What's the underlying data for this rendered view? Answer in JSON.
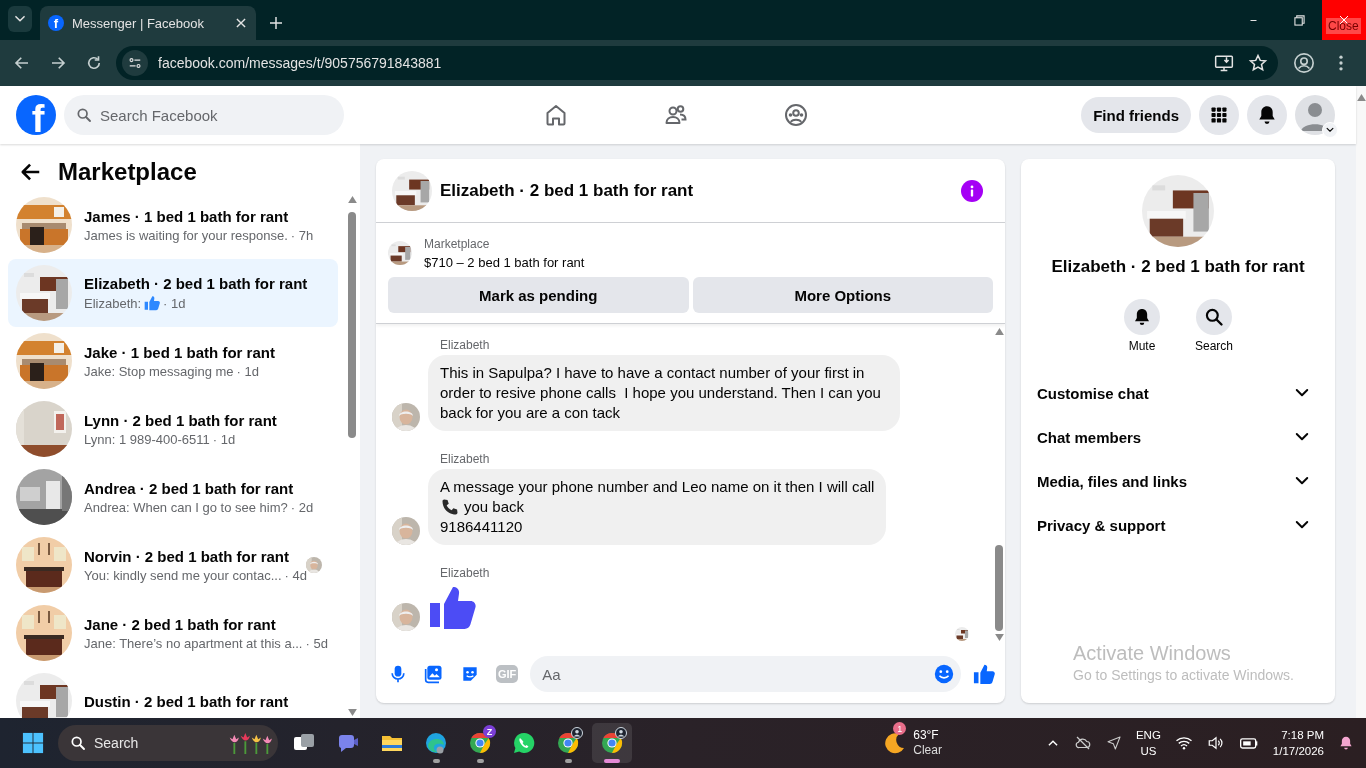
{
  "browser": {
    "tabs": [
      {
        "title": "Messenger | Facebook",
        "favicon_letter": "f",
        "selected": true
      }
    ],
    "url": "facebook.com/messages/t/905756791843881",
    "close_tooltip": "Close"
  },
  "topbar": {
    "logo_letter": "f",
    "search": {
      "placeholder": "Search Facebook"
    },
    "find_friends": "Find friends"
  },
  "sidebar": {
    "title": "Marketplace",
    "items": [
      {
        "name": "James · 1 bed 1 bath for rant",
        "preview": "James is waiting for your response.",
        "time": "· 7h",
        "like": false,
        "seen": false,
        "selected": false
      },
      {
        "name": "Elizabeth · 2 bed 1 bath for rant",
        "preview": "Elizabeth:",
        "time": "· 1d",
        "like": true,
        "seen": false,
        "selected": true
      },
      {
        "name": "Jake · 1 bed 1 bath for rant",
        "preview": "Jake: Stop messaging me",
        "time": "· 1d",
        "like": false,
        "seen": false,
        "selected": false
      },
      {
        "name": "Lynn · 2 bed 1 bath for rant",
        "preview": "Lynn: 1 989-400-6511",
        "time": "· 1d",
        "like": false,
        "seen": false,
        "selected": false
      },
      {
        "name": "Andrea · 2 bed 1 bath for rant",
        "preview": "Andrea: When can I go to see him?",
        "time": "· 2d",
        "like": false,
        "seen": false,
        "selected": false
      },
      {
        "name": "Norvin · 2 bed 1 bath for rant",
        "preview": "You: kindly send me your contac...",
        "time": "· 4d",
        "like": false,
        "seen": true,
        "selected": false
      },
      {
        "name": "Jane · 2 bed 1 bath for rant",
        "preview": "Jane: There’s no apartment at this a...",
        "time": "· 5d",
        "like": false,
        "seen": false,
        "selected": false
      },
      {
        "name": "Dustin · 2 bed 1 bath for rant",
        "like": false,
        "seen": false,
        "selected": false
      }
    ]
  },
  "chat": {
    "title": "Elizabeth · 2 bed 1 bath for rant",
    "listing": {
      "label": "Marketplace",
      "title": "$710 – 2 bed 1 bath for rant"
    },
    "actions": [
      "Mark as pending",
      "More Options"
    ],
    "messages": [
      {
        "sender": "Elizabeth",
        "kind": "text",
        "lines": [
          {
            "kind": "text",
            "text": "This in Sapulpa? I have to have a contact number of your first in order to resive phone calls  I hope you understand. Then I can you back for you are a con tack"
          }
        ]
      },
      {
        "sender": "Elizabeth",
        "kind": "text",
        "lines": [
          {
            "kind": "text",
            "text": "A message your phone number and Leo name on it then I will call"
          },
          {
            "kind": "call",
            "text": "you back"
          },
          {
            "kind": "text",
            "text": "9186441120"
          }
        ]
      },
      {
        "sender": "Elizabeth",
        "kind": "like"
      }
    ],
    "composer": {
      "gif_label": "GIF",
      "placeholder": "Aa"
    }
  },
  "info": {
    "title": "Elizabeth · 2 bed 1 bath for rant",
    "actions": [
      {
        "kind": "mute",
        "label": "Mute"
      },
      {
        "kind": "search",
        "label": "Search"
      }
    ],
    "sections": [
      {
        "label": "Customise chat",
        "expanded": false
      },
      {
        "label": "Chat members",
        "expanded": false
      },
      {
        "label": "Media, files and links",
        "expanded": false
      },
      {
        "label": "Privacy & support",
        "expanded": false
      }
    ]
  },
  "activation": {
    "title": "Activate Windows",
    "subtitle": "Go to Settings to activate Windows."
  },
  "taskbar": {
    "search": {
      "placeholder": "Search"
    },
    "apps": [
      {
        "kind": "taskview",
        "running": false,
        "selected": false
      },
      {
        "kind": "teams",
        "running": false,
        "selected": false
      },
      {
        "kind": "files",
        "running": false,
        "selected": false
      },
      {
        "kind": "edge",
        "running": true,
        "selected": false
      },
      {
        "kind": "chrome",
        "badge": "Z",
        "running": true,
        "selected": false
      },
      {
        "kind": "whatsapp",
        "running": false,
        "selected": false
      },
      {
        "kind": "chrome_profile",
        "running": true,
        "selected": false
      },
      {
        "kind": "chrome_profile",
        "running": true,
        "selected": true
      }
    ],
    "weather": {
      "badge": "1",
      "temperature": "63°F",
      "condition": "Clear"
    },
    "tray": {
      "language": "ENG",
      "region": "US",
      "time": "7:18 PM",
      "date": "1/17/2026"
    }
  }
}
